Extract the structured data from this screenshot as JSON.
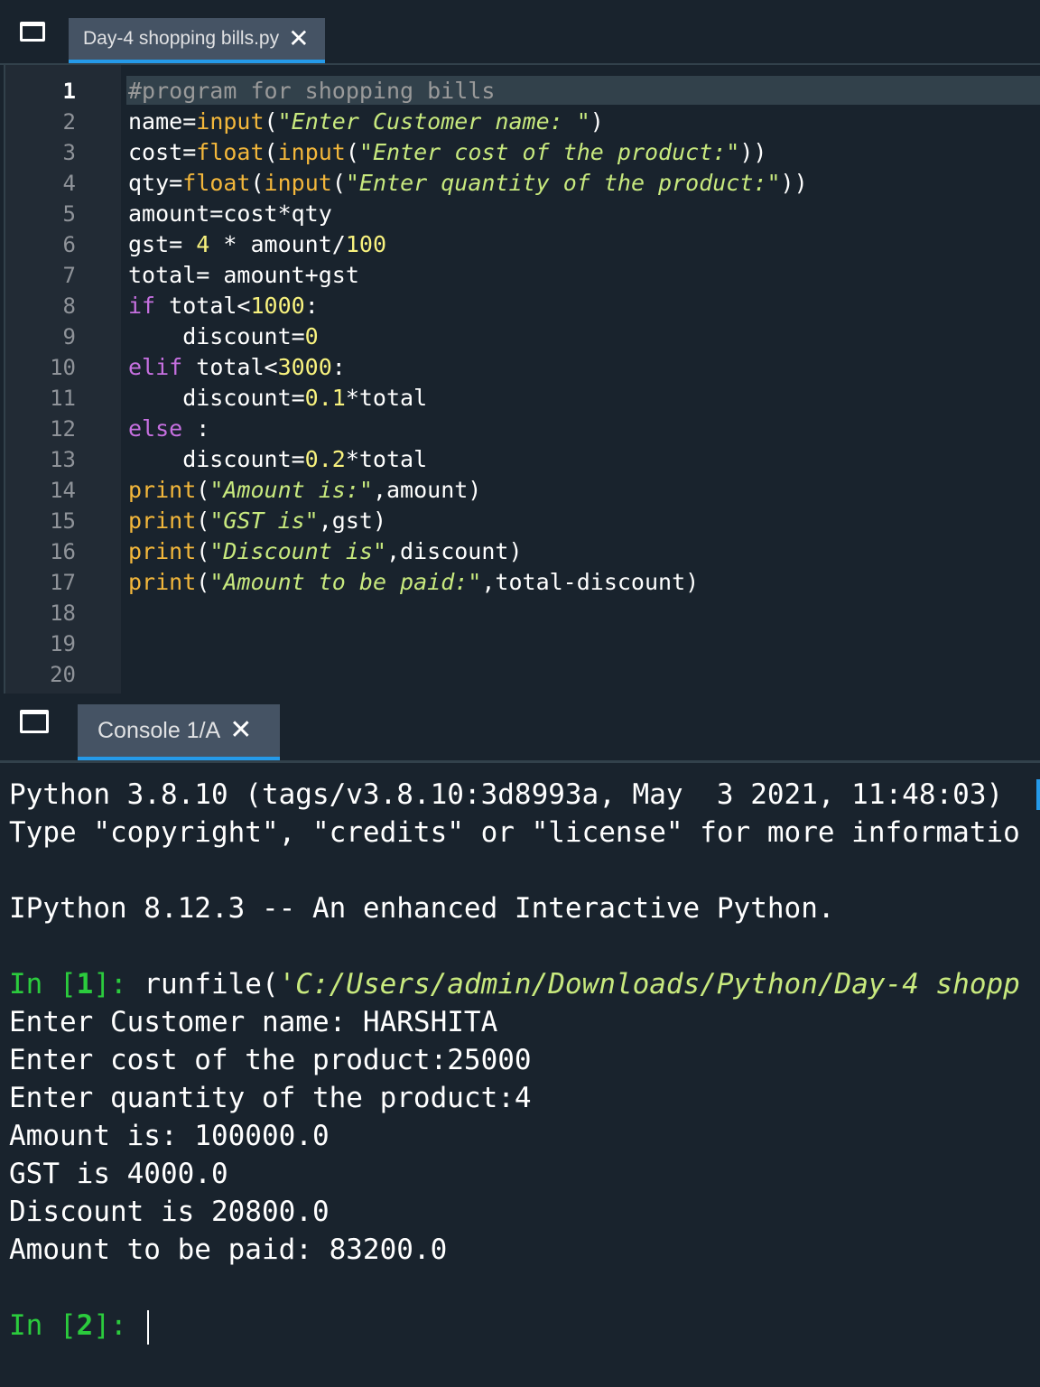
{
  "editor": {
    "tab_title": "Day-4 shopping bills.py",
    "tab_close": "✕",
    "line_numbers": [
      "1",
      "2",
      "3",
      "4",
      "5",
      "6",
      "7",
      "8",
      "9",
      "10",
      "11",
      "12",
      "13",
      "14",
      "15",
      "16",
      "17",
      "18",
      "19",
      "20"
    ],
    "code": {
      "l1": {
        "comment": "#program for shopping bills"
      },
      "l2": {
        "a": "name=",
        "b": "input",
        "c": "(",
        "d": "\"Enter Customer name: \"",
        "e": ")"
      },
      "l3": {
        "a": "cost=",
        "b": "float",
        "c": "(",
        "d": "input",
        "e": "(",
        "f": "\"Enter cost of the product:\"",
        "g": "))"
      },
      "l4": {
        "a": "qty=",
        "b": "float",
        "c": "(",
        "d": "input",
        "e": "(",
        "f": "\"Enter quantity of the product:\"",
        "g": "))"
      },
      "l5": {
        "a": "amount=cost*qty"
      },
      "l6": {
        "a": "gst= ",
        "b": "4",
        "c": " * amount/",
        "d": "100"
      },
      "l7": {
        "a": "total= amount+gst"
      },
      "l8": {
        "a": "if",
        "b": " total<",
        "c": "1000",
        "d": ":"
      },
      "l9": {
        "a": "    discount=",
        "b": "0"
      },
      "l10": {
        "a": "elif",
        "b": " total<",
        "c": "3000",
        "d": ":"
      },
      "l11": {
        "a": "    discount=",
        "b": "0.1",
        "c": "*total"
      },
      "l12": {
        "a": "else",
        "b": " :"
      },
      "l13": {
        "a": "    discount=",
        "b": "0.2",
        "c": "*total"
      },
      "l14": {
        "a": "print",
        "b": "(",
        "c": "\"Amount is:\"",
        "d": ",amount)"
      },
      "l15": {
        "a": "print",
        "b": "(",
        "c": "\"GST is\"",
        "d": ",gst)"
      },
      "l16": {
        "a": "print",
        "b": "(",
        "c": "\"Discount is\"",
        "d": ",discount)"
      },
      "l17": {
        "a": "print",
        "b": "(",
        "c": "\"Amount to be paid:\"",
        "d": ",total-discount)"
      }
    }
  },
  "console": {
    "tab_title": "Console 1/A",
    "tab_close": "✕",
    "banner1": "Python 3.8.10 (tags/v3.8.10:3d8993a, May  3 2021, 11:48:03)",
    "banner2": "Type \"copyright\", \"credits\" or \"license\" for more informatio",
    "banner3": "IPython 8.12.3 -- An enhanced Interactive Python.",
    "in1_prefix": "In [",
    "in1_num": "1",
    "in1_suffix": "]: ",
    "in1_call": "runfile(",
    "in1_arg": "'C:/Users/admin/Downloads/Python/Day-4 shopp",
    "out": [
      "Enter Customer name: HARSHITA",
      "Enter cost of the product:25000",
      "Enter quantity of the product:4",
      "Amount is: 100000.0",
      "GST is 4000.0",
      "Discount is 20800.0",
      "Amount to be paid: 83200.0"
    ],
    "in2_prefix": "In [",
    "in2_num": "2",
    "in2_suffix": "]: "
  }
}
